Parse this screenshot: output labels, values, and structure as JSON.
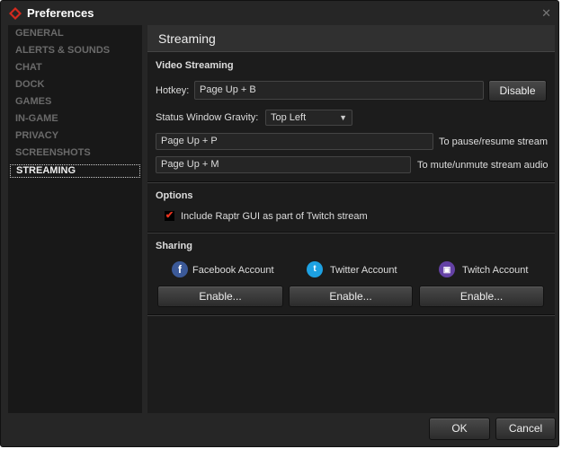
{
  "window": {
    "title": "Preferences"
  },
  "sidebar": {
    "items": [
      {
        "label": "GENERAL"
      },
      {
        "label": "ALERTS & SOUNDS"
      },
      {
        "label": "CHAT"
      },
      {
        "label": "DOCK"
      },
      {
        "label": "GAMES"
      },
      {
        "label": "IN-GAME"
      },
      {
        "label": "PRIVACY"
      },
      {
        "label": "SCREENSHOTS"
      },
      {
        "label": "STREAMING",
        "active": true
      }
    ]
  },
  "panel": {
    "title": "Streaming",
    "video": {
      "title": "Video Streaming",
      "hotkey_label": "Hotkey:",
      "hotkey_value": "Page Up + B",
      "disable_label": "Disable",
      "gravity_label": "Status Window Gravity:",
      "gravity_value": "Top Left",
      "pause_value": "Page Up + P",
      "pause_desc": "To pause/resume stream",
      "mute_value": "Page Up + M",
      "mute_desc": "To mute/unmute stream audio"
    },
    "options": {
      "title": "Options",
      "include_gui_label": "Include Raptr GUI as part of Twitch stream",
      "include_gui_checked": true
    },
    "sharing": {
      "title": "Sharing",
      "accounts": [
        {
          "label": "Facebook Account",
          "icon": "facebook-icon",
          "color": "#3b5998",
          "button": "Enable..."
        },
        {
          "label": "Twitter Account",
          "icon": "twitter-icon",
          "color": "#1da1e2",
          "button": "Enable..."
        },
        {
          "label": "Twitch Account",
          "icon": "twitch-icon",
          "color": "#6441a5",
          "button": "Enable..."
        }
      ]
    }
  },
  "footer": {
    "ok": "OK",
    "cancel": "Cancel"
  },
  "colors": {
    "accent": "#d42a1e"
  }
}
